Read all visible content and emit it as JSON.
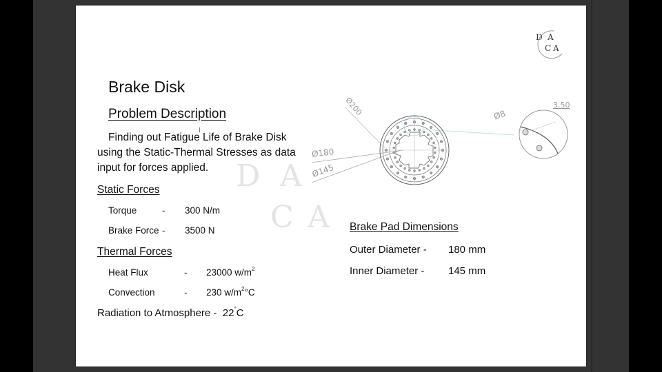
{
  "slide": {
    "title": "Brake Disk",
    "problem_heading": "Problem Description",
    "problem_text_line1": "Finding out Fatigue Life of Brake Disk",
    "problem_text_line2": "using the Static-Thermal Stresses as data",
    "problem_text_line3": "input for forces applied.",
    "static_forces": {
      "heading": "Static Forces",
      "rows": [
        {
          "label": "Torque",
          "sep": "-",
          "value": "300 N/m"
        },
        {
          "label": "Brake Force",
          "sep": "-",
          "value": "3500 N"
        }
      ]
    },
    "thermal_forces": {
      "heading": "Thermal Forces",
      "rows": [
        {
          "label": "Heat Flux",
          "sep": "-",
          "value": "23000 w/m",
          "sup": "2",
          "suffix": ""
        },
        {
          "label": "Convection",
          "sep": "-",
          "value": "230 w/m",
          "sup": "2",
          "suffix": "°C"
        }
      ]
    },
    "radiation": {
      "label": "Radiation to Atmosphere -",
      "value": "22",
      "sup": "°",
      "unit": "C"
    },
    "brake_pad": {
      "heading": "Brake Pad Dimensions",
      "rows": [
        {
          "label": "Outer Diameter -",
          "value": "180 mm"
        },
        {
          "label": "Inner Diameter  -",
          "value": "145 mm"
        }
      ]
    },
    "watermark": {
      "l1": "D",
      "l2": "A",
      "l3": "C",
      "l4": "A"
    },
    "logo": {
      "l1": "D",
      "l2": "A",
      "l3": "C",
      "l4": "A"
    },
    "drawing": {
      "dim_outer": "Ø200",
      "dim_pad_outer": "Ø180",
      "dim_pad_inner": "Ø145",
      "dim_hole": "Ø8",
      "thickness": "3.50",
      "cursor": "I"
    }
  }
}
